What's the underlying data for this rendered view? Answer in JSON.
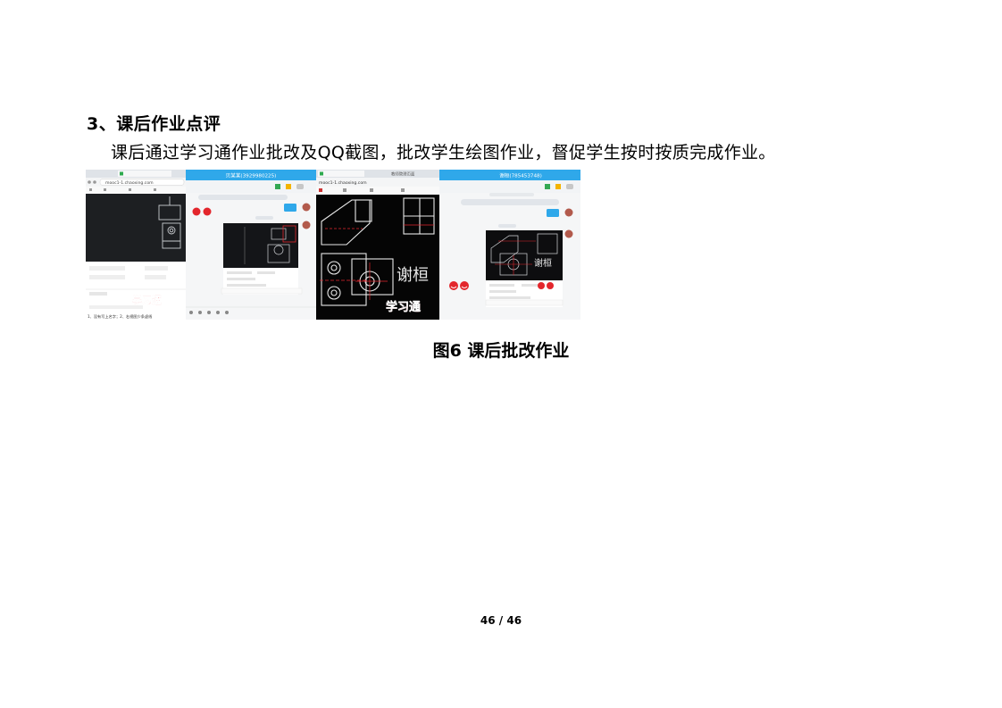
{
  "section": {
    "heading": "3、课后作业点评",
    "paragraph": "课后通过学习通作业批改及QQ截图，批改学生绘图作业，督促学生按时按质完成作业。"
  },
  "figure": {
    "caption": "图6  课后批改作业",
    "panel1": {
      "url": "mooc1-1.chaoxing.com",
      "watermark": "学习通",
      "line1": "1、没有写上名字；2、右视图少条虚线"
    },
    "panel2": {
      "title": "贝某某(3929980225)"
    },
    "panel3": {
      "url": "mooc1-1.chaoxing.com",
      "tab": "教师管理页面",
      "signature": "谢桓",
      "watermark": "学习通"
    },
    "panel4": {
      "title": "谢桓(785453748)",
      "signature": "谢桓"
    }
  },
  "footer": {
    "page": "46 / 46"
  },
  "colors": {
    "qq_blue": "#2fa8ea",
    "cad_bg": "#050505",
    "watermark_red": "#e3262c"
  }
}
